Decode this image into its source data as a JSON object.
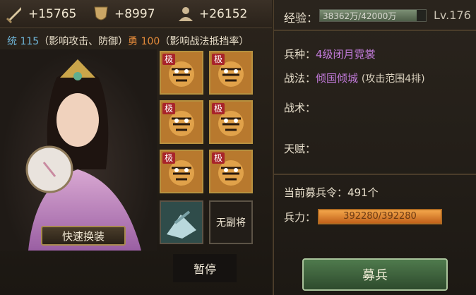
{
  "stats": {
    "attack": {
      "icon": "sword-icon",
      "value": "+15765"
    },
    "defense": {
      "icon": "shield-icon",
      "value": "+8997"
    },
    "troops": {
      "icon": "person-icon",
      "value": "+26152"
    }
  },
  "attributes": {
    "tong_label": "统 115",
    "tong_note": "（影响攻击、防御）",
    "yong_label": "勇 100",
    "yong_note": "（影响战法抵挡率）"
  },
  "equipment": [
    {
      "badge": "极",
      "icon": "tiger-icon"
    },
    {
      "badge": "极",
      "icon": "tiger-icon"
    },
    {
      "badge": "极",
      "icon": "tiger-icon"
    },
    {
      "badge": "极",
      "icon": "tiger-icon"
    },
    {
      "badge": "极",
      "icon": "tiger-icon"
    },
    {
      "badge": "极",
      "icon": "tiger-icon"
    }
  ],
  "quick_equip_label": "快速换装",
  "no_deputy_label": "无副将",
  "pause_label": "暂停",
  "right": {
    "exp_label": "经验：",
    "exp_text": "38362万/42000万",
    "exp_progress": 0.913,
    "level": "Lv.176",
    "unit_type_label": "兵种：",
    "unit_type_value": "4级闭月霓裳",
    "tactic_label": "战法：",
    "tactic_value": "倾国倾城",
    "tactic_note": "(攻击范围4排)",
    "skill_label": "战术：",
    "talent_label": "天赋：",
    "recruit_token": "当前募兵令：491个",
    "troops_label": "兵力：",
    "troops_text": "392280/392280",
    "troops_progress": 1.0,
    "recruit_button": "募兵"
  },
  "colors": {
    "tong": "#6fb6d9",
    "yong": "#e58b3a",
    "purple": "#c17ad9",
    "gold_frame": "#b7913f",
    "recruit_green": "#4f7a4d"
  }
}
